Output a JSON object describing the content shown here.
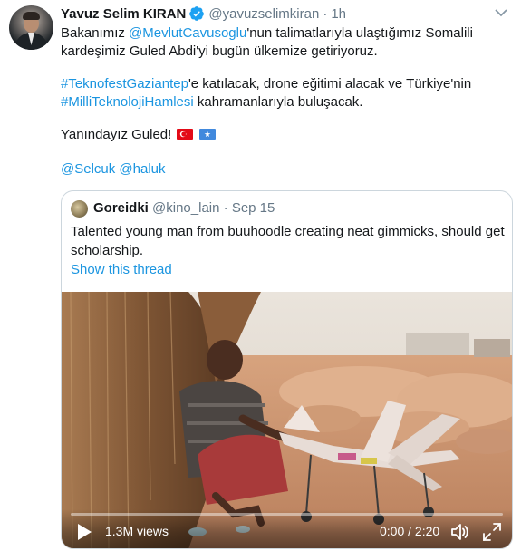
{
  "tweet": {
    "display_name": "Yavuz Selim KIRAN",
    "handle": "@yavuzselimkiran",
    "separator": "·",
    "time": "1h",
    "line1_prefix": "Bakanımız ",
    "line1_mention": "@MevlutCavusoglu",
    "line1_suffix": "'nun talimatlarıyla ulaştığımız Somalili",
    "line2": "kardeşimiz Guled Abdi'yi bugün ülkemize getiriyoruz.",
    "line3_hashtag": "#TeknofestGaziantep",
    "line3_suffix": "'e katılacak, drone eğitimi alacak ve Türkiye'nin",
    "line4_hashtag": "#MilliTeknolojiHamlesi",
    "line4_suffix": " kahramanlarıyla buluşacak.",
    "line5": "Yanındayız Guled!",
    "flags": [
      "turkey-flag-icon",
      "somalia-flag-icon"
    ],
    "mention_1": "@Selcuk",
    "mention_2": "@haluk"
  },
  "quote": {
    "display_name": "Goreidki",
    "handle": "@kino_lain",
    "separator": "·",
    "date": "Sep 15",
    "text_line1": "Talented young man from buuhoodle creating neat gimmicks, should get",
    "text_line2": "scholarship.",
    "show_thread": "Show this thread"
  },
  "video": {
    "views": "1.3M views",
    "timecode": "0:00 / 2:20",
    "progress": 0.0,
    "icons": [
      "play-icon",
      "volume-icon",
      "fullscreen-icon"
    ]
  },
  "colors": {
    "link": "#1b95e0",
    "verified": "#1da1f2",
    "muted": "#657786",
    "border": "#ccd6dd"
  }
}
